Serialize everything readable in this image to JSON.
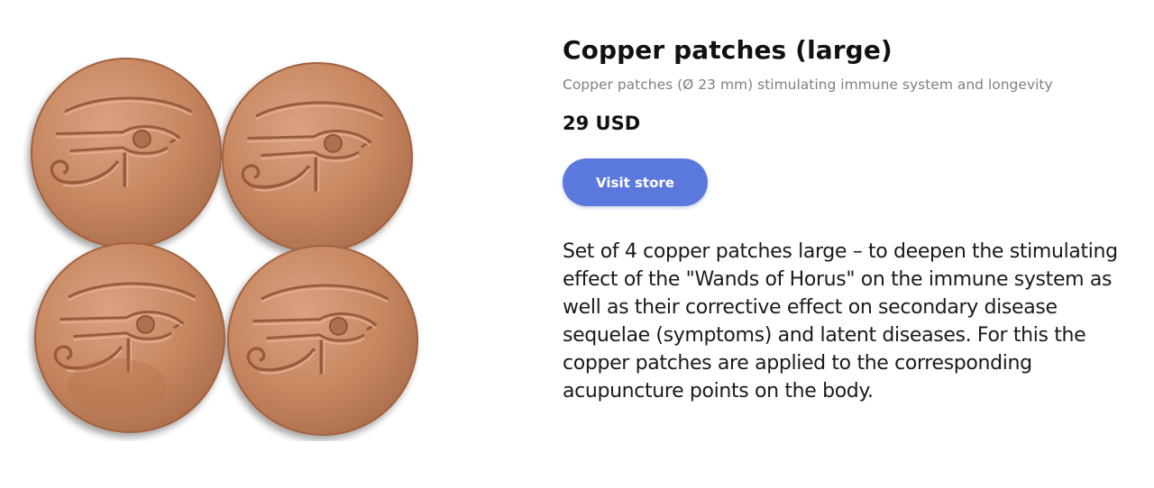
{
  "product": {
    "title": "Copper patches (large)",
    "subtitle": "Copper patches (Ø 23 mm) stimulating immune system and longevity",
    "price": "29 USD",
    "visit_button_label": "Visit store",
    "description": "Set of 4 copper patches large – to deepen the stimulating effect of the \"Wands of Horus\" on the immune system as well as their corrective effect on secondary disease sequelae (symptoms) and latent diseases. For this the copper patches are applied to the corresponding acupuncture points on the body."
  },
  "image": {
    "alt": "Four copper patches with Eye of Horus emblem",
    "coin_icon": "eye-of-horus-icon"
  },
  "colors": {
    "accent": "#5b79dc",
    "title_text": "#111111",
    "subtitle_text": "#808080",
    "copper": "#c98a63",
    "copper_dark": "#a9684a"
  }
}
